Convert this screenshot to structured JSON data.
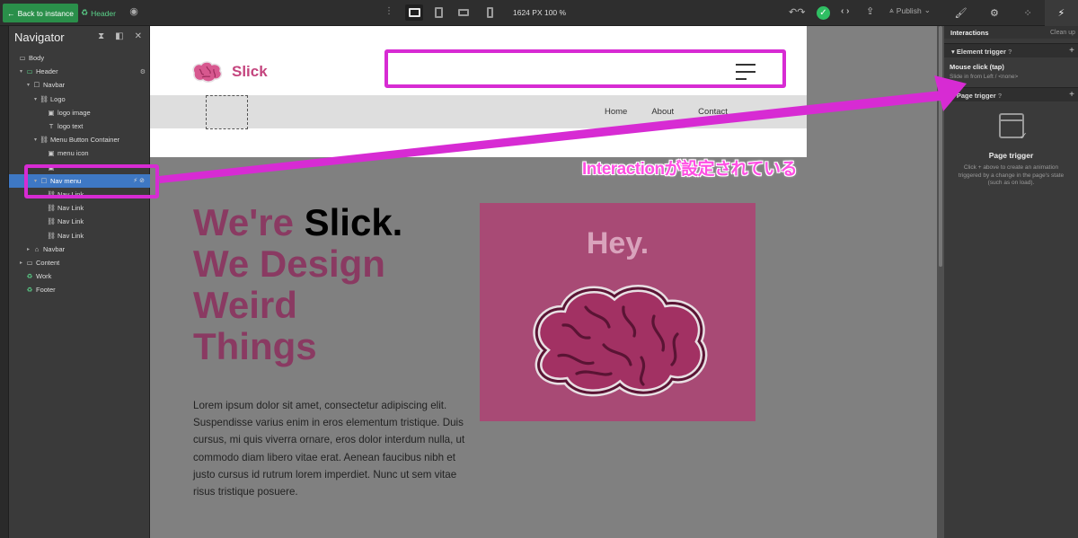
{
  "topbar": {
    "back_label": "Back to instance",
    "back_icon": "←",
    "crumb_label": "Header",
    "viewport_readout": "1624 PX  100 %",
    "publish_label": "Publish"
  },
  "navigator": {
    "title": "Navigator",
    "tree": [
      {
        "label": "Body",
        "icon": "▭",
        "depth": 0,
        "caret": ""
      },
      {
        "label": "Header",
        "icon": "▭",
        "depth": 1,
        "caret": "▾",
        "green": true
      },
      {
        "label": "Navbar",
        "icon": "☐",
        "depth": 2,
        "caret": "▾"
      },
      {
        "label": "Logo",
        "icon": "⛓",
        "depth": 3,
        "caret": "▾"
      },
      {
        "label": "logo image",
        "icon": "▣",
        "depth": 4,
        "caret": ""
      },
      {
        "label": "logo text",
        "icon": "T",
        "depth": 4,
        "caret": ""
      },
      {
        "label": "Menu Button Container",
        "icon": "⛓",
        "depth": 3,
        "caret": "▾"
      },
      {
        "label": "menu icon",
        "icon": "▣",
        "depth": 4,
        "caret": ""
      },
      {
        "label": "",
        "icon": "▣",
        "depth": 4,
        "caret": ""
      },
      {
        "label": "Nav menu",
        "icon": "☐",
        "depth": 3,
        "caret": "▾",
        "selected": true
      },
      {
        "label": "Nav Link",
        "icon": "⛓",
        "depth": 4,
        "caret": ""
      },
      {
        "label": "Nav Link",
        "icon": "⛓",
        "depth": 4,
        "caret": ""
      },
      {
        "label": "Nav Link",
        "icon": "⛓",
        "depth": 4,
        "caret": ""
      },
      {
        "label": "Nav Link",
        "icon": "⛓",
        "depth": 4,
        "caret": ""
      },
      {
        "label": "Navbar",
        "icon": "⌂",
        "depth": 2,
        "caret": "▸"
      },
      {
        "label": "Content",
        "icon": "▭",
        "depth": 1,
        "caret": "▸"
      },
      {
        "label": "Work",
        "icon": "♻",
        "depth": 1,
        "caret": "",
        "green": true
      },
      {
        "label": "Footer",
        "icon": "♻",
        "depth": 1,
        "caret": "",
        "green": true
      }
    ]
  },
  "site": {
    "brand": "Slick",
    "navlinks": [
      "Home",
      "About",
      "Contact"
    ],
    "hero_line1a": "We're ",
    "hero_line1b": "Slick.",
    "hero_line2": "We Design",
    "hero_line3": "Weird",
    "hero_line4": "Things",
    "hero_text": "Lorem ipsum dolor sit amet, consectetur adipiscing elit. Suspendisse varius enim in eros elementum tristique. Duis cursus, mi quis viverra ornare, eros dolor interdum nulla, ut commodo diam libero vitae erat. Aenean faucibus nibh et justo cursus id rutrum lorem imperdiet. Nunc ut sem vitae risus tristique posuere.",
    "card_heading": "Hey."
  },
  "interactions": {
    "title": "Interactions",
    "clean_up": "Clean up",
    "element_trigger": "Element trigger",
    "trigger_name": "Mouse click (tap)",
    "trigger_sub": "Slide in from Left / <none>",
    "page_trigger": "Page trigger",
    "page_trigger_title": "Page trigger",
    "page_trigger_desc": "Click + above to create an animation triggered by a change in the page's state (such as on load)."
  },
  "annotation": {
    "text": "Interactionが設定されている",
    "color": "#d72bd3"
  }
}
